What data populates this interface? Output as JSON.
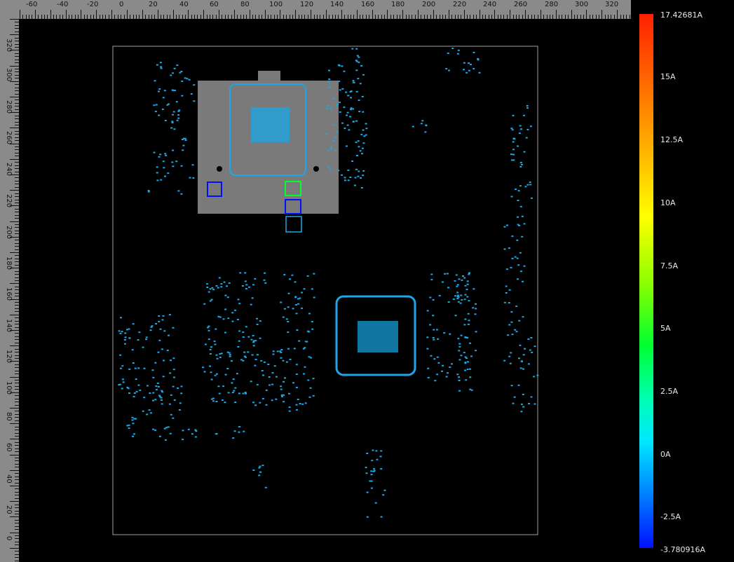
{
  "ruler": {
    "top_labels": [
      "-60",
      "-40",
      "-20",
      "0",
      "20",
      "40",
      "60",
      "80",
      "100",
      "120",
      "140",
      "160",
      "180",
      "200",
      "220",
      "240",
      "260",
      "280",
      "300",
      "320"
    ],
    "left_labels": [
      "320",
      "300",
      "280",
      "260",
      "240",
      "220",
      "200",
      "180",
      "160",
      "140",
      "120",
      "100",
      "80",
      "60",
      "40",
      "20",
      "0"
    ]
  },
  "colorbar": {
    "labels": [
      "17.42681A",
      "15A",
      "12.5A",
      "10A",
      "7.5A",
      "5A",
      "2.5A",
      "0A",
      "-2.5A",
      "-3.780916A"
    ],
    "max_value": 17.42681,
    "min_value": -3.780916,
    "colors": {
      "high": "#ff2000",
      "mid": "#00ff30",
      "zero": "#00e8ff",
      "low": "#0010ff"
    }
  },
  "board": {
    "outline_color": "#a0a0a0",
    "pad_color": "#1aa8e8",
    "socket_color": "#7a7a7a"
  }
}
